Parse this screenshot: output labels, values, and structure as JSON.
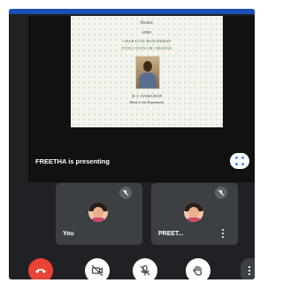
{
  "shared_content": {
    "line1": "Prentic",
    "line2": "APRIL",
    "line3": "CHARACTE BUILDERSIP",
    "line4": "EVELUTION OR CHANGE",
    "line5": "M. S. JAYAKUMAR",
    "line6": "Head of the Department"
  },
  "presenting": {
    "label": "FREETHA is presenting"
  },
  "participants": [
    {
      "name": "You",
      "muted": true
    },
    {
      "name": "PREET...",
      "muted": true
    }
  ],
  "controls": {
    "end_call": "end-call-icon",
    "video": "video-off-icon",
    "mic": "mic-off-icon",
    "hand": "raise-hand-icon",
    "more": "more-vert-icon"
  },
  "colors": {
    "end_call": "#ea4335",
    "background": "#202124",
    "tile": "#3c4043"
  }
}
